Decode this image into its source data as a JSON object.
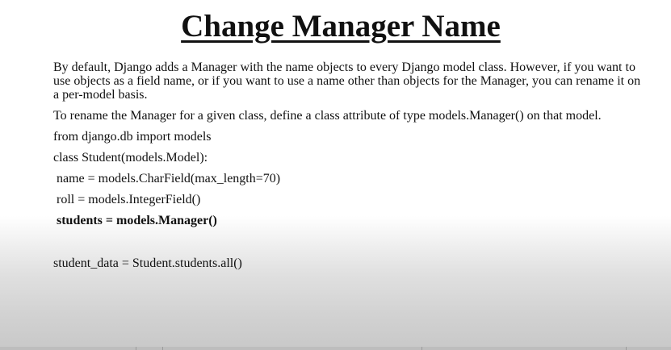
{
  "slide": {
    "title": "Change Manager Name",
    "paragraph1": "By default, Django adds a Manager with the name objects to every Django model class. However, if you want to use objects as a field name, or if you want to use a name other than objects for the Manager, you can rename it on a per-model basis.",
    "paragraph2": "To rename the Manager for a given class, define a class attribute of type models.Manager() on that model.",
    "code": {
      "import_line": "from django.db import models",
      "class_line": "class Student(models.Model):",
      "name_line": "name = models.CharField(max_length=70)",
      "roll_line": "roll = models.IntegerField()",
      "manager_line": "students = models.Manager()",
      "query_line": "student_data = Student.students.all()"
    }
  }
}
